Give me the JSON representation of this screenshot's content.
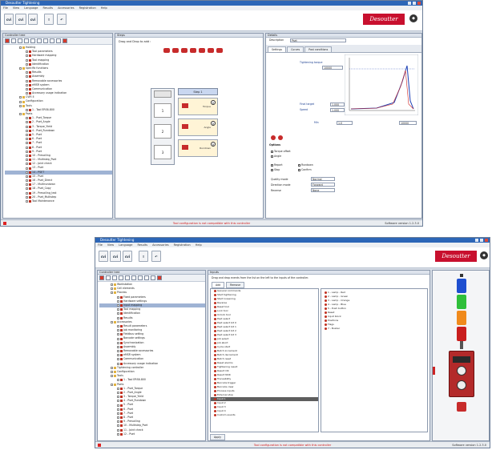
{
  "top_window": {
    "title": "Desoutter Tightening",
    "menu": [
      "File",
      "View",
      "Language",
      "Results",
      "Accessories",
      "Registration",
      "Help"
    ],
    "brand": "Desoutter",
    "left_panel": {
      "title": "Controller tree",
      "tree": [
        {
          "label": "Holding",
          "icon": "folder"
        },
        {
          "label": "Tool parameters",
          "icon": "item"
        },
        {
          "label": "Hardware mapping",
          "icon": "item"
        },
        {
          "label": "Tool mapping",
          "icon": "item"
        },
        {
          "label": "Identification",
          "icon": "item"
        },
        {
          "label": "Specific functions",
          "icon": "folder"
        },
        {
          "label": "Results",
          "icon": "item"
        },
        {
          "label": "Assembly",
          "icon": "item"
        },
        {
          "label": "Removable accessories",
          "icon": "item"
        },
        {
          "label": "eMSR system",
          "icon": "item"
        },
        {
          "label": "Communication",
          "icon": "item"
        },
        {
          "label": "Accessory usage indication",
          "icon": "item"
        },
        {
          "label": "CVIR II",
          "icon": "folder"
        },
        {
          "label": "Configuration",
          "icon": "folder"
        },
        {
          "label": "Tools",
          "icon": "folder"
        },
        {
          "label": "1 - Tool ERS6-800",
          "icon": "item"
        },
        {
          "label": "Psets",
          "icon": "folder"
        },
        {
          "label": "1 - Pset_Torque",
          "icon": "item"
        },
        {
          "label": "2 - Pset_Angle",
          "icon": "item"
        },
        {
          "label": "3 - Torque_Yield",
          "icon": "item"
        },
        {
          "label": "4 - Pset_Rundown",
          "icon": "item"
        },
        {
          "label": "5 - Pset",
          "icon": "item"
        },
        {
          "label": "6 - Pset",
          "icon": "item"
        },
        {
          "label": "7 - Pset",
          "icon": "item"
        },
        {
          "label": "8 - Pset",
          "icon": "item"
        },
        {
          "label": "9 - Pset",
          "icon": "item"
        },
        {
          "label": "10 - Prevailing",
          "icon": "item"
        },
        {
          "label": "11 - Multistep_Pset",
          "icon": "item"
        },
        {
          "label": "12 - Joint check",
          "icon": "item"
        },
        {
          "label": "13 - Pset",
          "icon": "item"
        },
        {
          "label": "14 - PSET",
          "icon": "item",
          "selected": true
        },
        {
          "label": "15 - Pset",
          "icon": "item"
        },
        {
          "label": "16 - Pset_Direct",
          "icon": "item"
        },
        {
          "label": "17 - Multirundown",
          "icon": "item"
        },
        {
          "label": "18 - Pset_Copy",
          "icon": "item"
        },
        {
          "label": "19 - Prevailing_test",
          "icon": "item"
        },
        {
          "label": "20 - Pset_Multistep",
          "icon": "item"
        },
        {
          "label": "Tool Maintenance",
          "icon": "item"
        }
      ]
    },
    "middle_panel": {
      "title": "Steps",
      "hint": "Drag and Drop to add :",
      "seq_head": "Step 1",
      "step_buttons": [
        "1",
        "2",
        "3"
      ],
      "cards": [
        "Torque",
        "Angle",
        "Rundown"
      ]
    },
    "right_panel": {
      "title": "Details",
      "tabs": [
        "Settings",
        "Curves",
        "Post conditions"
      ],
      "desc_label": "Description",
      "desc_value": "Pset",
      "fields": [
        {
          "label": "Tightening torque",
          "value": "10000"
        },
        {
          "label": "Final target",
          "value": "1.000"
        },
        {
          "label": "Speed",
          "value": "1.000"
        },
        {
          "label": "Min",
          "value": "1.0"
        },
        {
          "label": "Max",
          "value": "10000"
        }
      ],
      "options_title": "Options",
      "checkboxes": [
        "Torque offset",
        "Angle",
        "Report",
        "Stop",
        "Rundown",
        "Confirm"
      ],
      "dropdowns": [
        {
          "label": "Quality mode",
          "value": "Normal"
        },
        {
          "label": "Direction mode",
          "value": "Forward"
        },
        {
          "label": "Reverse",
          "value": "None"
        }
      ]
    },
    "status_warning": "Tool configuration is not compatible with this controller",
    "status_version": "Software version 1.2.3.0"
  },
  "bottom_window": {
    "title": "Desoutter Tightening",
    "menu": [
      "File",
      "View",
      "Language",
      "Results",
      "Accessories",
      "Registration",
      "Help"
    ],
    "brand": "Desoutter",
    "left_panel": {
      "title": "Controller tree",
      "tree": [
        {
          "label": "Workstation",
          "icon": "folder"
        },
        {
          "label": "Cell elements",
          "icon": "folder"
        },
        {
          "label": "Process",
          "icon": "folder"
        },
        {
          "label": "Fixed parameters",
          "icon": "item"
        },
        {
          "label": "Hardware settings",
          "icon": "item"
        },
        {
          "label": "Input mapping",
          "icon": "item",
          "selected": true
        },
        {
          "label": "Tool mapping",
          "icon": "item"
        },
        {
          "label": "Identification",
          "icon": "item"
        },
        {
          "label": "Results",
          "icon": "item"
        },
        {
          "label": "Accessories",
          "icon": "folder"
        },
        {
          "label": "Result parameters",
          "icon": "item"
        },
        {
          "label": "Job monitoring",
          "icon": "item"
        },
        {
          "label": "Fieldbus setting",
          "icon": "item"
        },
        {
          "label": "Barcode settings",
          "icon": "item"
        },
        {
          "label": "Synchronization",
          "icon": "item"
        },
        {
          "label": "Assembly",
          "icon": "item"
        },
        {
          "label": "Removable accessories",
          "icon": "item"
        },
        {
          "label": "eMSR system",
          "icon": "item"
        },
        {
          "label": "Communication",
          "icon": "item"
        },
        {
          "label": "Accessory usage indication",
          "icon": "item"
        },
        {
          "label": "Tightening controller",
          "icon": "folder"
        },
        {
          "label": "Configuration",
          "icon": "folder"
        },
        {
          "label": "Tools",
          "icon": "folder"
        },
        {
          "label": "1 - Tool ERS6-800",
          "icon": "item"
        },
        {
          "label": "Psets",
          "icon": "folder"
        },
        {
          "label": "1 - Pset_Torque",
          "icon": "item"
        },
        {
          "label": "2 - Pset_Angle",
          "icon": "item"
        },
        {
          "label": "3 - Torque_Yield",
          "icon": "item"
        },
        {
          "label": "4 - Pset_Rundown",
          "icon": "item"
        },
        {
          "label": "5 - Pset",
          "icon": "item"
        },
        {
          "label": "6 - Pset",
          "icon": "item"
        },
        {
          "label": "7 - Pset",
          "icon": "item"
        },
        {
          "label": "8 - Pset",
          "icon": "item"
        },
        {
          "label": "9 - Prevailing",
          "icon": "item"
        },
        {
          "label": "10 - Multistep_Pset",
          "icon": "item"
        },
        {
          "label": "11 - Joint check",
          "icon": "item"
        },
        {
          "label": "12 - Pset",
          "icon": "item"
        }
      ]
    },
    "center_panel": {
      "title": "Inputs",
      "hint": "Drag and drop events from the list on the left to the inputs of the controller.",
      "tab_buttons": [
        "Add",
        "Remove"
      ],
      "events": [
        "General commands",
        "Start tightening",
        "Start loosening",
        "Reverse",
        "Reset tool",
        "Lock tool",
        "Unlock tool",
        "Pset select",
        "Pset select bit 0",
        "Pset select bit 1",
        "Pset select bit 2",
        "Pset select bit 3",
        "Job select",
        "Job abort",
        "Cycle start",
        "Batch increment",
        "Batch decrement",
        "Batch reset",
        "Reset alarms",
        "Tightening result",
        "Result OK",
        "Result NOK",
        "Traceability",
        "Barcode trigger",
        "Barcode clear",
        "Process inputs",
        "External stop",
        "Input 1",
        "Input 2",
        "Input 3",
        "Input 4",
        "Custom events"
      ],
      "selected_event_index": 27,
      "footer_button": "Apply"
    },
    "mapping_panel": {
      "rows": [
        {
          "label": "1 - Lamp - Red"
        },
        {
          "label": "2 - Lamp - Green"
        },
        {
          "label": "3 - Lamp - Orange"
        },
        {
          "label": "4 - Lamp - Blue"
        },
        {
          "label": "5 - Push button"
        },
        {
          "label": "Reset"
        },
        {
          "label": "Input block"
        },
        {
          "label": "Positions"
        },
        {
          "label": "Flags"
        },
        {
          "label": "7 - Buzzer"
        }
      ]
    },
    "tower_lights": [
      {
        "name": "blue",
        "color": "#1f4fd0"
      },
      {
        "name": "green",
        "color": "#2fbf3a"
      },
      {
        "name": "orange",
        "color": "#f08a1c"
      },
      {
        "name": "red",
        "color": "#c91e1e"
      }
    ],
    "status_warning": "Tool configuration is not compatible with this controller",
    "status_version": "Software version 1.2.3.0"
  }
}
